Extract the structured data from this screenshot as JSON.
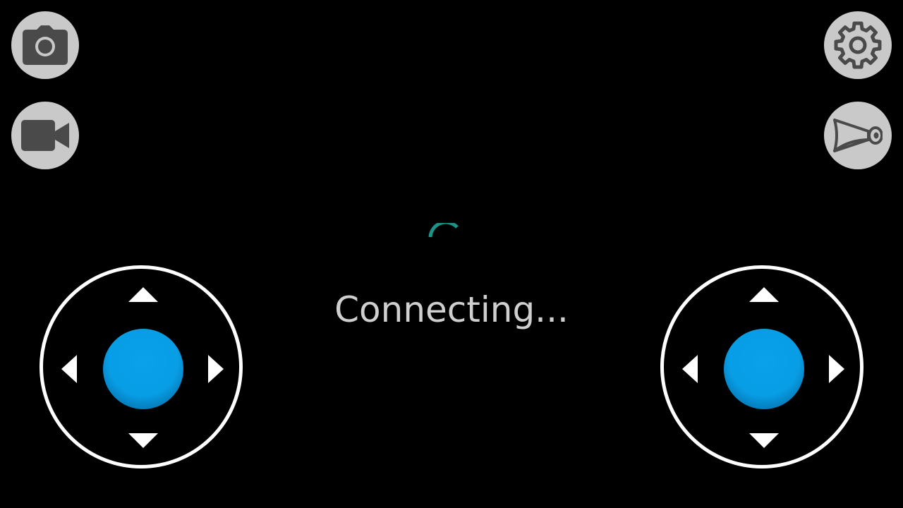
{
  "status": {
    "text": "Connecting..."
  },
  "colors": {
    "background": "#000000",
    "button_fill": "#c9c9c9",
    "icon_fill": "#4a4a4a",
    "spinner": "#1a9488",
    "status_text": "#cfcfcf",
    "joystick_ring": "#ffffff",
    "joystick_knob": "#0a9fe8"
  },
  "buttons": {
    "top_left": {
      "icon": "camera-icon"
    },
    "left_second": {
      "icon": "video-camera-icon"
    },
    "top_right": {
      "icon": "gear-icon"
    },
    "right_second": {
      "icon": "horn-icon"
    }
  },
  "joysticks": [
    {
      "side": "left",
      "arrows": [
        "up",
        "down",
        "left",
        "right"
      ]
    },
    {
      "side": "right",
      "arrows": [
        "up",
        "down",
        "left",
        "right"
      ]
    }
  ]
}
